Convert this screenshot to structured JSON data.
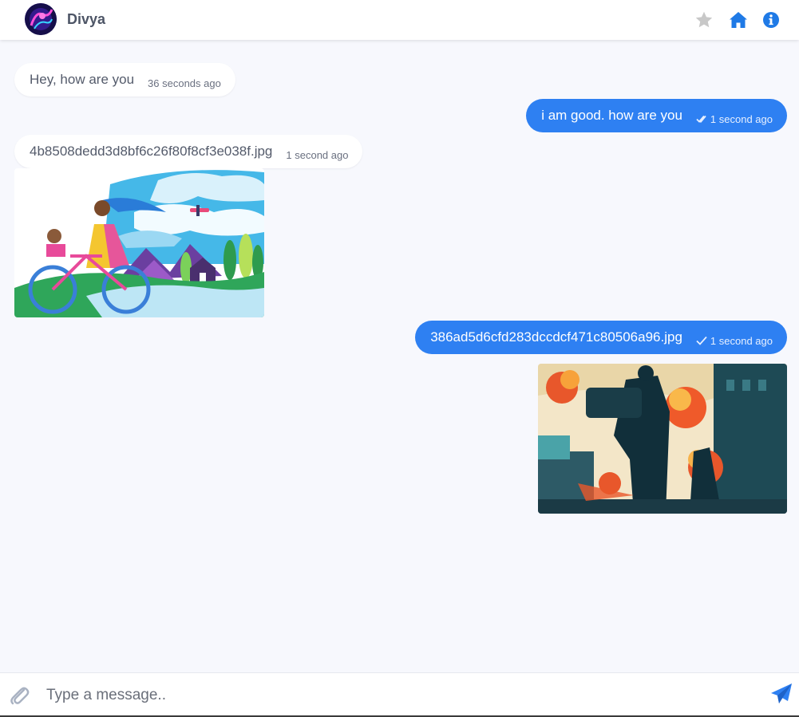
{
  "header": {
    "contact_name": "Divya",
    "icons": [
      "star-icon",
      "home-icon",
      "info-icon"
    ]
  },
  "messages": [
    {
      "direction": "incoming",
      "text": "Hey, how are you",
      "time": "36 seconds ago"
    },
    {
      "direction": "outgoing",
      "text": "i am good. how are you",
      "time": "1 second ago",
      "status": "read"
    },
    {
      "direction": "incoming",
      "text": "4b8508dedd3d8bf6c26f80f8cf3e038f.jpg",
      "time": "1 second ago",
      "attachment": "image"
    },
    {
      "direction": "outgoing",
      "text": "386ad5d6cfd283dccdcf471c80506a96.jpg",
      "time": "1 second ago",
      "status": "sent",
      "attachment": "image"
    }
  ],
  "composer": {
    "placeholder": "Type a message.."
  },
  "colors": {
    "accent": "#2e80f2",
    "background": "#f7f8fd",
    "incoming_bubble": "#ffffff",
    "star_inactive": "#c8c8c8"
  }
}
